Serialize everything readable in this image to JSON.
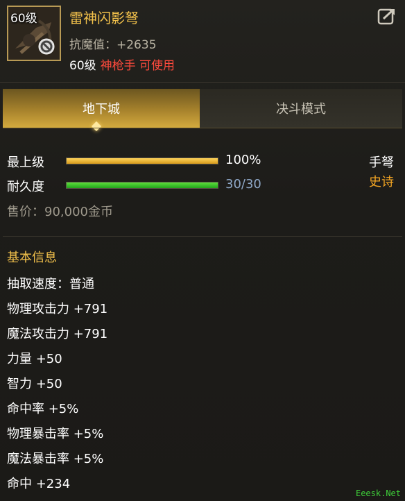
{
  "item": {
    "level_badge": "60级",
    "name": "雷神闪影弩",
    "stat": "抗魔值：+2635",
    "req_level": "60级",
    "req_class": "神枪手 可使用",
    "icons": {
      "forbid": "forbid-icon",
      "share": "share-icon"
    }
  },
  "tabs": [
    {
      "label": "地下城",
      "active": true
    },
    {
      "label": "决斗模式",
      "active": false
    }
  ],
  "quality": {
    "label": "最上级",
    "value_text": "100%",
    "fill": 1.0
  },
  "durability": {
    "label": "耐久度",
    "value_text": "30/30",
    "fill": 1.0
  },
  "weapon_type": "手弩",
  "rarity": "史诗",
  "price": "售价：90,000金币",
  "basic_info": {
    "title": "基本信息",
    "lines": [
      "抽取速度：普通",
      "物理攻击力 +791",
      "魔法攻击力 +791",
      "力量 +50",
      "智力 +50",
      "命中率 +5%",
      "物理暴击率 +5%",
      "魔法暴击率 +5%",
      "命中 +234"
    ]
  },
  "watermark": "Eeesk.Net",
  "colors": {
    "gold": "#f2c14b",
    "red": "#ff4a3d",
    "quality_bar": "#f0b230",
    "durability_bar": "#3cc22a",
    "durability_text": "#8fa8c8",
    "rarity": "#f5a623"
  }
}
